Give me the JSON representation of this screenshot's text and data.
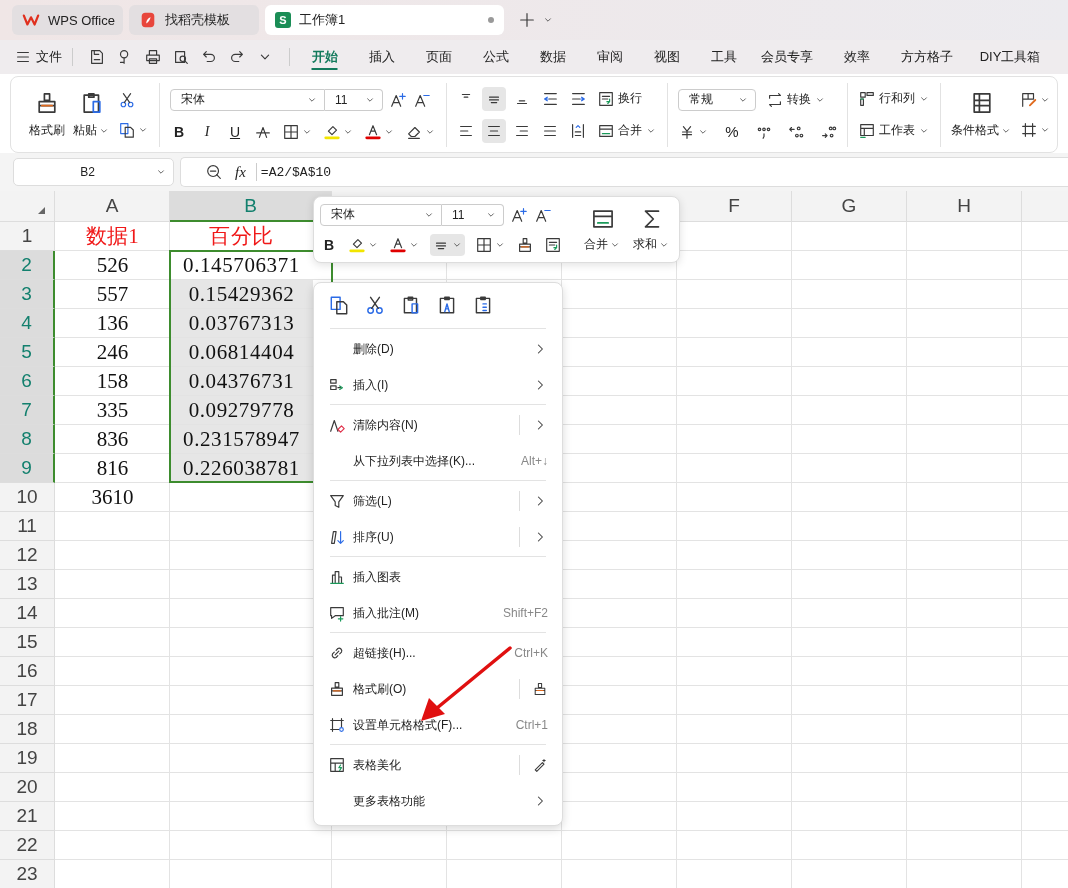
{
  "tabs": [
    {
      "label": "WPS Office",
      "selected": false
    },
    {
      "label": "找稻壳模板",
      "selected": false
    },
    {
      "label": "工作簿1",
      "selected": true,
      "badge": "S"
    }
  ],
  "menu_bar": {
    "file": "文件",
    "tabs": [
      {
        "label": "开始",
        "selected": true
      },
      {
        "label": "插入",
        "selected": false
      },
      {
        "label": "页面",
        "selected": false
      },
      {
        "label": "公式",
        "selected": false
      },
      {
        "label": "数据",
        "selected": false
      },
      {
        "label": "审阅",
        "selected": false
      },
      {
        "label": "视图",
        "selected": false
      },
      {
        "label": "工具",
        "selected": false
      },
      {
        "label": "会员专享",
        "selected": false
      },
      {
        "label": "效率",
        "selected": false
      },
      {
        "label": "方方格子",
        "selected": false
      },
      {
        "label": "DIY工具箱",
        "selected": false
      }
    ]
  },
  "ribbon": {
    "format_painter": "格式刷",
    "paste": "粘贴",
    "font": "宋体",
    "size": "11",
    "bold": "B",
    "italic": "I",
    "underline": "U",
    "wrap": "换行",
    "merge": "合并",
    "number_format": "常规",
    "convert": "转换",
    "percent": "%",
    "row_col": "行和列",
    "sheet": "工作表",
    "conditional": "条件格式"
  },
  "formula_bar": {
    "cell": "B2",
    "fx": "fx",
    "formula": "=A2/$A$10"
  },
  "sheet": {
    "columns": [
      {
        "label": "A",
        "selected": false
      },
      {
        "label": "B",
        "selected": true
      },
      {
        "label": "F",
        "selected": false
      },
      {
        "label": "G",
        "selected": false
      },
      {
        "label": "H",
        "selected": false
      }
    ],
    "rows": [
      {
        "number": "1",
        "kind": "header",
        "selected": false,
        "cells": [
          "数据1",
          "百分比"
        ]
      },
      {
        "number": "2",
        "kind": "data",
        "selected": true,
        "active": true,
        "cells": [
          "526",
          "0.145706371"
        ]
      },
      {
        "number": "3",
        "kind": "data",
        "selected": true,
        "active": false,
        "cells": [
          "557",
          "0.15429362"
        ]
      },
      {
        "number": "4",
        "kind": "data",
        "selected": true,
        "active": false,
        "cells": [
          "136",
          "0.03767313"
        ]
      },
      {
        "number": "5",
        "kind": "data",
        "selected": true,
        "active": false,
        "cells": [
          "246",
          "0.06814404"
        ]
      },
      {
        "number": "6",
        "kind": "data",
        "selected": true,
        "active": false,
        "cells": [
          "158",
          "0.04376731"
        ]
      },
      {
        "number": "7",
        "kind": "data",
        "selected": true,
        "active": false,
        "cells": [
          "335",
          "0.09279778"
        ]
      },
      {
        "number": "8",
        "kind": "data",
        "selected": true,
        "active": false,
        "cells": [
          "836",
          "0.231578947"
        ]
      },
      {
        "number": "9",
        "kind": "data",
        "selected": true,
        "active": false,
        "cells": [
          "816",
          "0.226038781"
        ]
      },
      {
        "number": "10",
        "kind": "data",
        "selected": false,
        "cells": [
          "3610"
        ]
      },
      {
        "number": "11",
        "selected": false
      },
      {
        "number": "12",
        "selected": false
      },
      {
        "number": "13",
        "selected": false
      },
      {
        "number": "14",
        "selected": false
      },
      {
        "number": "15",
        "selected": false
      },
      {
        "number": "16",
        "selected": false
      },
      {
        "number": "17",
        "selected": false
      },
      {
        "number": "18",
        "selected": false
      },
      {
        "number": "19",
        "selected": false
      },
      {
        "number": "20",
        "selected": false
      },
      {
        "number": "21",
        "selected": false
      },
      {
        "number": "22",
        "selected": false
      },
      {
        "number": "23",
        "selected": false
      }
    ]
  },
  "mini_toolbar": {
    "font": "宋体",
    "size": "11",
    "bold": "B",
    "merge": "合并",
    "sum": "求和"
  },
  "context_menu": {
    "groups": [
      [
        {
          "label": "删除(D)",
          "submenu": true,
          "split": false
        },
        {
          "label": "插入(I)",
          "submenu": true,
          "split": false
        }
      ],
      [
        {
          "label": "清除内容(N)",
          "submenu": true,
          "split": true
        },
        {
          "label": "从下拉列表中选择(K)...",
          "shortcut": "Alt+↓",
          "submenu": false,
          "split": false
        }
      ],
      [
        {
          "label": "筛选(L)",
          "submenu": true,
          "split": true
        },
        {
          "label": "排序(U)",
          "submenu": true,
          "split": true
        }
      ],
      [
        {
          "label": "插入图表",
          "submenu": false,
          "split": false
        },
        {
          "label": "插入批注(M)",
          "shortcut": "Shift+F2",
          "submenu": false,
          "split": false
        }
      ],
      [
        {
          "label": "超链接(H)...",
          "shortcut": "Ctrl+K",
          "submenu": false,
          "split": false
        },
        {
          "label": "格式刷(O)",
          "submenu": false,
          "split": true
        },
        {
          "label": "设置单元格格式(F)...",
          "shortcut": "Ctrl+1",
          "submenu": false,
          "split": false
        }
      ],
      [
        {
          "label": "表格美化",
          "submenu": false,
          "split": true
        },
        {
          "label": "更多表格功能",
          "submenu": true,
          "split": false
        }
      ]
    ]
  }
}
